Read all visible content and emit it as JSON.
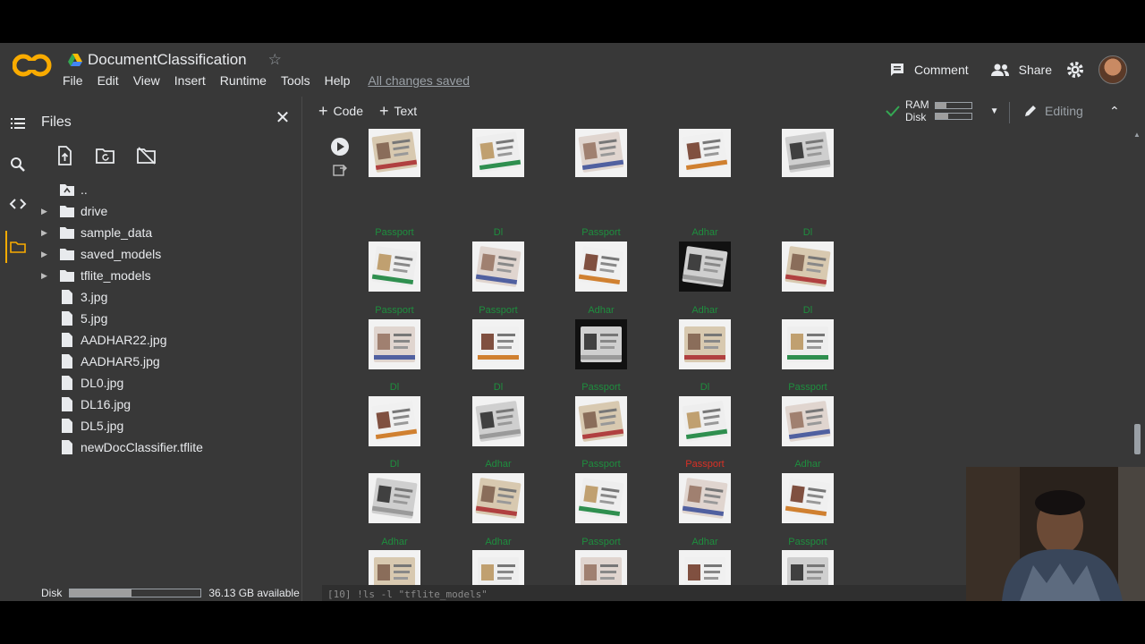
{
  "header": {
    "title": "DocumentClassification",
    "menu": [
      "File",
      "Edit",
      "View",
      "Insert",
      "Runtime",
      "Tools",
      "Help"
    ],
    "save_status": "All changes saved",
    "comment_label": "Comment",
    "share_label": "Share"
  },
  "sidebar": {
    "title": "Files",
    "files": [
      {
        "name": "..",
        "type": "parent"
      },
      {
        "name": "drive",
        "type": "folder"
      },
      {
        "name": "sample_data",
        "type": "folder"
      },
      {
        "name": "saved_models",
        "type": "folder"
      },
      {
        "name": "tflite_models",
        "type": "folder"
      },
      {
        "name": "3.jpg",
        "type": "file"
      },
      {
        "name": "5.jpg",
        "type": "file"
      },
      {
        "name": "AADHAR22.jpg",
        "type": "file"
      },
      {
        "name": "AADHAR5.jpg",
        "type": "file"
      },
      {
        "name": "DL0.jpg",
        "type": "file"
      },
      {
        "name": "DL16.jpg",
        "type": "file"
      },
      {
        "name": "DL5.jpg",
        "type": "file"
      },
      {
        "name": "newDocClassifier.tflite",
        "type": "file"
      }
    ],
    "disk_label": "Disk",
    "disk_available": "36.13 GB available",
    "disk_used_fraction": 0.47
  },
  "toolbar": {
    "code_label": "Code",
    "text_label": "Text",
    "ram_label": "RAM",
    "disk_label": "Disk",
    "ram_fraction": 0.3,
    "disk_fraction": 0.35,
    "editing_label": "Editing"
  },
  "output": {
    "rows": [
      {
        "labels": [
          "",
          "",
          "",
          "",
          ""
        ]
      },
      {
        "labels": [
          "Passport",
          "Dl",
          "Passport",
          "Adhar",
          "Dl"
        ]
      },
      {
        "labels": [
          "Passport",
          "Passport",
          "Adhar",
          "Adhar",
          "Dl"
        ]
      },
      {
        "labels": [
          "Dl",
          "Dl",
          "Passport",
          "Dl",
          "Passport"
        ]
      },
      {
        "labels": [
          "Dl",
          "Adhar",
          "Passport",
          "Passport",
          "Adhar"
        ]
      },
      {
        "labels": [
          "Adhar",
          "Adhar",
          "Passport",
          "Adhar",
          "Passport"
        ]
      }
    ],
    "label_colors": {
      "correct": "#1e8e3e",
      "wrong": "#d93025"
    },
    "wrong_cells": [
      [
        4,
        3
      ]
    ],
    "next_cell_code": "[10] !ls -l \"tflite_models\""
  },
  "colors": {
    "background": "#383838",
    "accent_orange": "#f9ab00",
    "check_green": "#34a853"
  }
}
